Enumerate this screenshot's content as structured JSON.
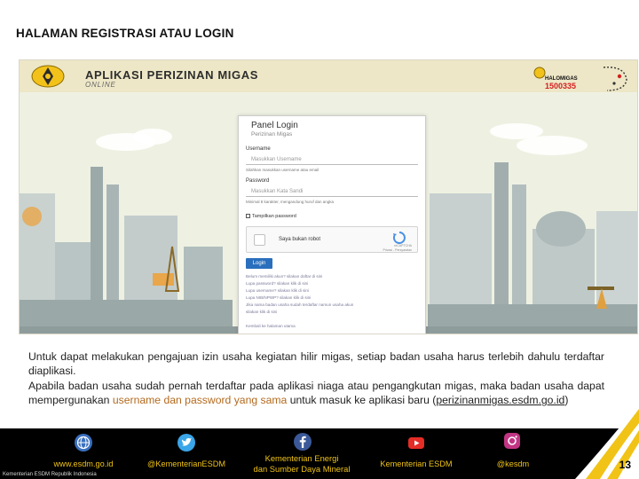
{
  "slide": {
    "title": "HALAMAN REGISTRASI ATAU LOGIN",
    "page_number": "13"
  },
  "app": {
    "title": "APLIKASI PERIZINAN MIGAS",
    "subtitle": "ONLINE",
    "halo_name": "HALOMIGAS",
    "halo_number": "1500335"
  },
  "panel": {
    "title": "Panel Login",
    "subtitle": "Perizinan Migas",
    "username_label": "Username",
    "username_placeholder": "Masukkan Username",
    "username_hint": "Silahkan masukkan username atau email",
    "password_label": "Password",
    "password_placeholder": "Masukkan Kata Sandi",
    "password_hint": "Minimal 8 karakter, mengandung huruf dan angka",
    "show_password": "Tampilkan password",
    "captcha_label": "Saya bukan robot",
    "captcha_brand": "reCAPTCHA",
    "captcha_terms": "Privasi - Persyaratan",
    "login_button": "Login",
    "links": [
      "Belum memiliki akun? silakan daftar di sini",
      "Lupa password? silakan klik di sini",
      "Lupa username? silakan klik di sini",
      "Lupa NIB/NPWP? silakan klik di sini",
      "Jika nama badan usaha sudah terdaftar namun usaha akun",
      "silakan klik di sini",
      "",
      "Kembali ke halaman utama"
    ]
  },
  "description": {
    "p1": "Untuk dapat melakukan pengajuan izin usaha kegiatan hilir migas, setiap badan usaha harus terlebih dahulu terdaftar diaplikasi.",
    "p2_start": "Apabila badan usaha sudah pernah terdaftar pada aplikasi niaga atau pengangkutan migas, maka badan usaha dapat mempergunakan ",
    "p2_highlight": "username dan password yang sama",
    "p2_end": " untuk masuk ke aplikasi baru (",
    "p2_link": "perizinanmigas.esdm.go.id",
    "p2_close": ")"
  },
  "footer": {
    "website": "www.esdm.go.id",
    "twitter": "@KementerianESDM",
    "ministry_line1": "Kementerian Energi",
    "ministry_line2": "dan Sumber Daya Mineral",
    "youtube": "Kementerian ESDM",
    "instagram": "@kesdm",
    "copyright": "Kementerian ESDM Republik Indonesia"
  },
  "colors": {
    "accent_orange": "#b36a1e",
    "footer_yellow": "#f0c316",
    "login_blue": "#2a6fbd",
    "halo_red": "#d42020"
  }
}
